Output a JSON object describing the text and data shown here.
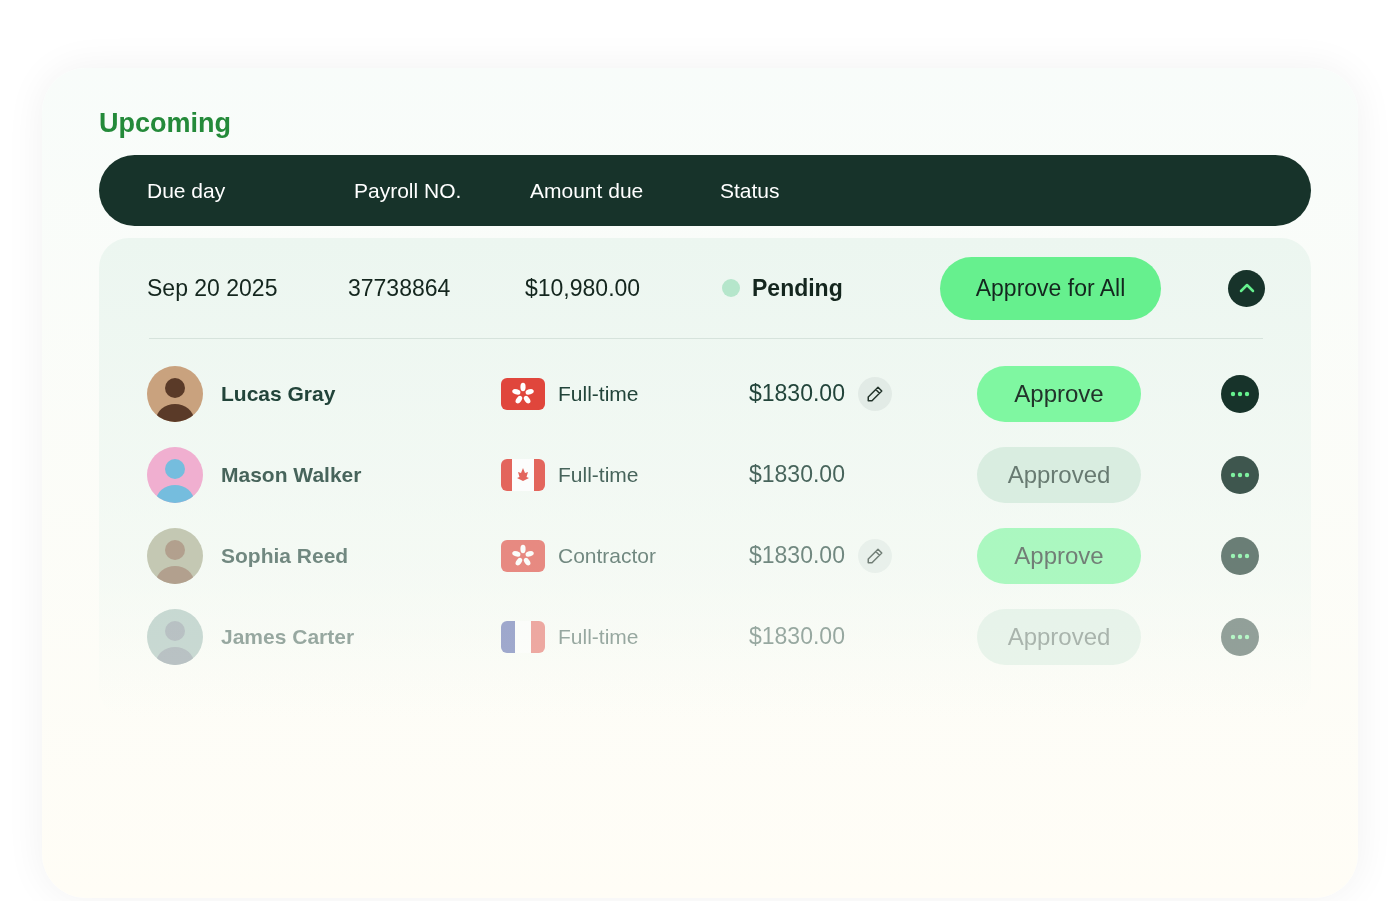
{
  "title": "Upcoming",
  "columns": [
    "Due day",
    "Payroll NO.",
    "Amount due",
    "Status"
  ],
  "batch": {
    "due_day": "Sep 20 2025",
    "payroll_no": "37738864",
    "amount_due": "$10,980.00",
    "status": "Pending",
    "approve_all_label": "Approve for All",
    "expanded": true,
    "employees": [
      {
        "name": "Lucas Gray",
        "flag": {
          "kind": "hk"
        },
        "type": "Full-time",
        "amount": "$1830.00",
        "approved": false,
        "action": "Approve"
      },
      {
        "name": "Mason Walker",
        "flag": {
          "kind": "ca"
        },
        "type": "Full-time",
        "amount": "$1830.00",
        "approved": true,
        "action": "Approved"
      },
      {
        "name": "Sophia Reed",
        "flag": {
          "kind": "hk"
        },
        "type": "Contractor",
        "amount": "$1830.00",
        "approved": false,
        "action": "Approve"
      },
      {
        "name": "James Carter",
        "flag": {
          "kind": "fr"
        },
        "type": "Full-time",
        "amount": "$1830.00",
        "approved": true,
        "action": "Approved"
      }
    ]
  }
}
